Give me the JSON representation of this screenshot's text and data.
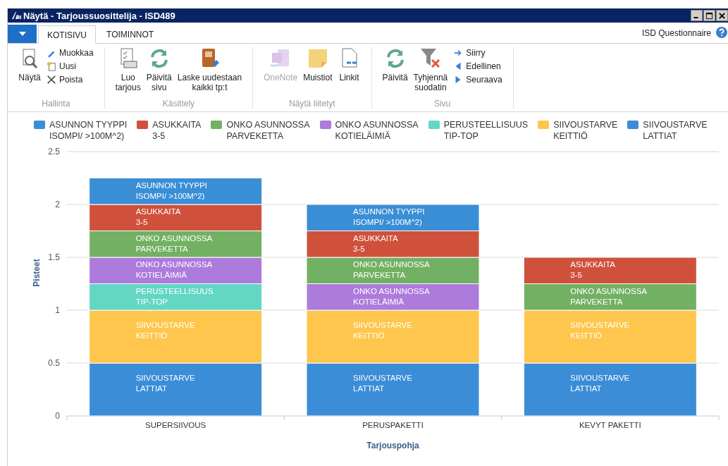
{
  "window": {
    "title": "Näytä - Tarjoussuosittelija - ISD489"
  },
  "tabs": [
    {
      "label": "KOTISIVU",
      "selected": true
    },
    {
      "label": "TOIMINNOT",
      "selected": false
    }
  ],
  "company": "ISD Questionnaire",
  "ribbon": [
    {
      "label": "Hallinta",
      "large": [
        {
          "label": "Näytä",
          "disabled": false
        }
      ],
      "small": [
        {
          "label": "Muokkaa"
        },
        {
          "label": "Uusi"
        },
        {
          "label": "Poista"
        }
      ]
    },
    {
      "label": "Käsittely",
      "large": [
        {
          "label": "Luo\ntarjous",
          "disabled": false
        },
        {
          "label": "Päivitä\nsivu",
          "disabled": false
        },
        {
          "label": "Laske uudestaan\nkaikki tp:t",
          "disabled": false
        }
      ]
    },
    {
      "label": "Näytä liitetyt",
      "large": [
        {
          "label": "OneNote",
          "disabled": true
        },
        {
          "label": "Muistiot",
          "disabled": false
        },
        {
          "label": "Linkit",
          "disabled": false
        }
      ]
    },
    {
      "label": "Sivu",
      "large": [
        {
          "label": "Päivitä",
          "disabled": false
        },
        {
          "label": "Tyhjennä\nsuodatin",
          "disabled": false
        }
      ],
      "small": [
        {
          "label": "Siirry"
        },
        {
          "label": "Edellinen"
        },
        {
          "label": "Seuraava"
        }
      ]
    }
  ],
  "chart": {
    "chart_data": {
      "type": "bar",
      "stacked": true,
      "xlabel": "Tarjouspohja",
      "ylabel": "Pisteet",
      "categories": [
        "SUPERSIIVOUS",
        "PERUSPAKETTI",
        "KEVYT PAKETTI"
      ],
      "ylim": [
        0,
        2.5
      ],
      "grid": true,
      "legend": true,
      "yticks": [
        0,
        0.5,
        1,
        1.5,
        2,
        2.5
      ],
      "series": [
        {
          "name": "ASUNNON TYYPPI\nISOMPI/ >100M^2)",
          "color": "#3a8ed6",
          "values": [
            0.25,
            0.25,
            null
          ]
        },
        {
          "name": "ASUKKAITA\n3-5",
          "color": "#cf513c",
          "values": [
            0.25,
            0.25,
            0.25
          ]
        },
        {
          "name": "ONKO ASUNNOSSA\nPARVEKETTA",
          "color": "#72b163",
          "values": [
            0.25,
            0.25,
            0.25
          ]
        },
        {
          "name": "ONKO ASUNNOSSA\nKOTIELÄIMIÄ",
          "color": "#ac7bdc",
          "values": [
            0.25,
            0.25,
            null
          ]
        },
        {
          "name": "PERUSTEELLISUUS\nTIP-TOP",
          "color": "#63d6c4",
          "values": [
            0.25,
            null,
            null
          ]
        },
        {
          "name": "SIIVOUSTARVE\nKEITTIÖ",
          "color": "#fec64c",
          "values": [
            0.5,
            0.5,
            0.5
          ]
        },
        {
          "name": "SIIVOUSTARVE\nLATTIAT",
          "color": "#3b8dd7",
          "values": [
            0.5,
            0.5,
            0.5
          ]
        }
      ],
      "value_labels": [
        [
          "ASUNNON TYYPPI\nISOMPI/ >100M^2)",
          "ASUNNON TYYPPI\nISOMPI/ >100M^2)",
          null
        ],
        [
          "ASUKKAITA\n3-5",
          "ASUKKAITA\n3-5",
          "ASUKKAITA\n3-5"
        ],
        [
          "ONKO ASUNNOSSA\nPARVEKETTA",
          "ONKO ASUNNOSSA\nPARVEKETTA",
          "ONKO ASUNNOSSA\nPARVEKETTA"
        ],
        [
          "ONKO ASUNNOSSA\nKOTIELÄIMIÄ",
          "ONKO ASUNNOSSA\nKOTIELÄIMIÄ",
          null
        ],
        [
          "PERUSTEELLISUUS\nTIP-TOP",
          null,
          null
        ],
        [
          "SIIVOUSTARVE\nKEITTIÖ",
          "SIIVOUSTARVE\nKEITTIÖ",
          "SIIVOUSTARVE\nKEITTIÖ"
        ],
        [
          "SIIVOUSTARVE\nLATTIAT",
          "SIIVOUSTARVE\nLATTIAT",
          "SIIVOUSTARVE\nLATTIAT"
        ]
      ]
    }
  }
}
